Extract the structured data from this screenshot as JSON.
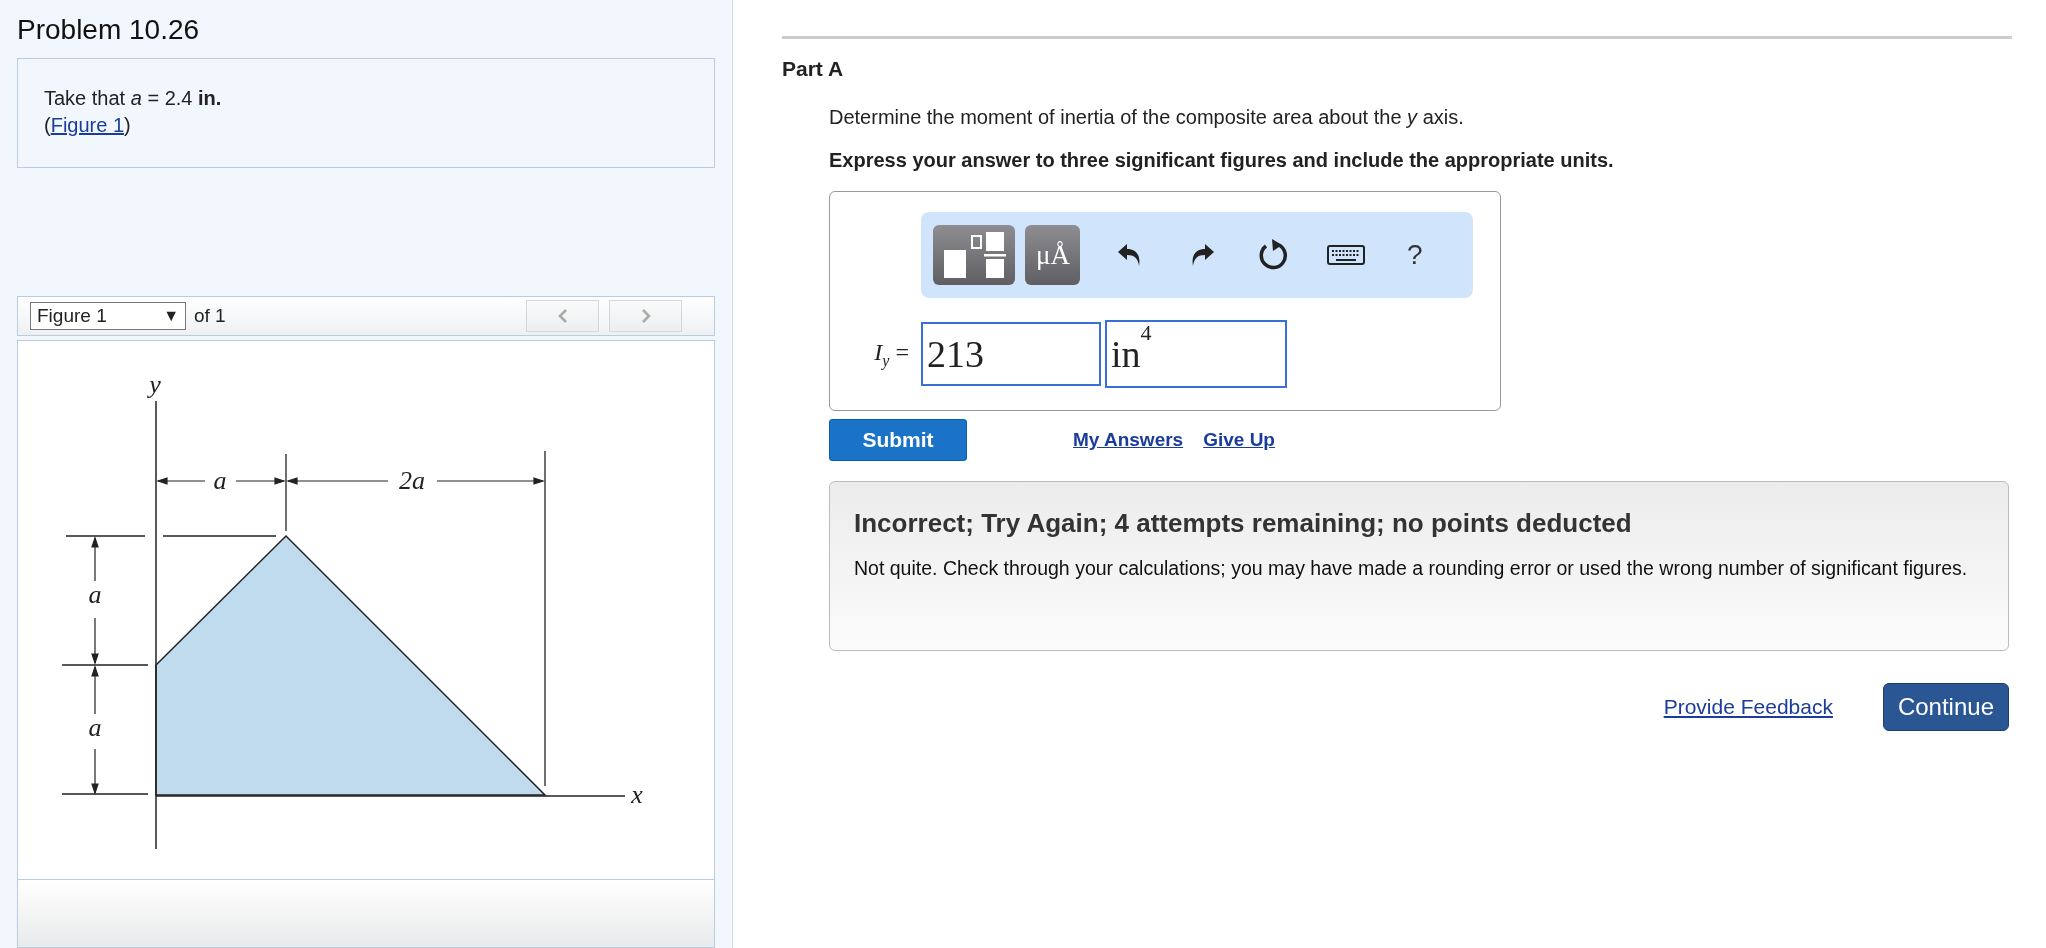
{
  "problem": {
    "title": "Problem 10.26",
    "given": "Take that *a* = 2.4 **in.**",
    "figure_ref": {
      "open": "(",
      "link": "Figure 1",
      "close": ")"
    }
  },
  "figure": {
    "select": {
      "value": "Figure 1",
      "caret": "▼"
    },
    "count": "of 1",
    "labels": [
      {
        "kind": "axis-y",
        "text": "y"
      },
      {
        "kind": "axis-x",
        "text": "x"
      },
      {
        "kind": "dim-top-left",
        "text": "a"
      },
      {
        "kind": "dim-top-right",
        "text": "2a"
      },
      {
        "kind": "dim-side-upper",
        "text": "a"
      },
      {
        "kind": "dim-side-lower",
        "text": "a"
      }
    ]
  },
  "part": {
    "title": "Part A",
    "question": "Determine the moment of inertia of the composite area about the *y* axis.",
    "instruction": "Express your answer to three significant figures and include the appropriate units."
  },
  "toolbar": [
    {
      "kind": "templates"
    },
    {
      "kind": "units",
      "text": "μÅ"
    },
    {
      "kind": "undo"
    },
    {
      "kind": "redo"
    },
    {
      "kind": "reset"
    },
    {
      "kind": "keyboard"
    },
    {
      "kind": "help",
      "text": "?"
    }
  ],
  "answer": {
    "label": "*I*$_{y}$ =",
    "value": "213",
    "units": "in$^{4}$"
  },
  "actions": {
    "submit": "Submit",
    "links": [
      "My Answers",
      "Give Up"
    ]
  },
  "feedback": {
    "title": "Incorrect; Try Again; 4 attempts remaining; no points deducted",
    "message": "Not quite. Check through your calculations; you may have made a rounding error or used the wrong number of significant figures."
  },
  "footer": {
    "link": "Provide Feedback",
    "button": "Continue"
  }
}
